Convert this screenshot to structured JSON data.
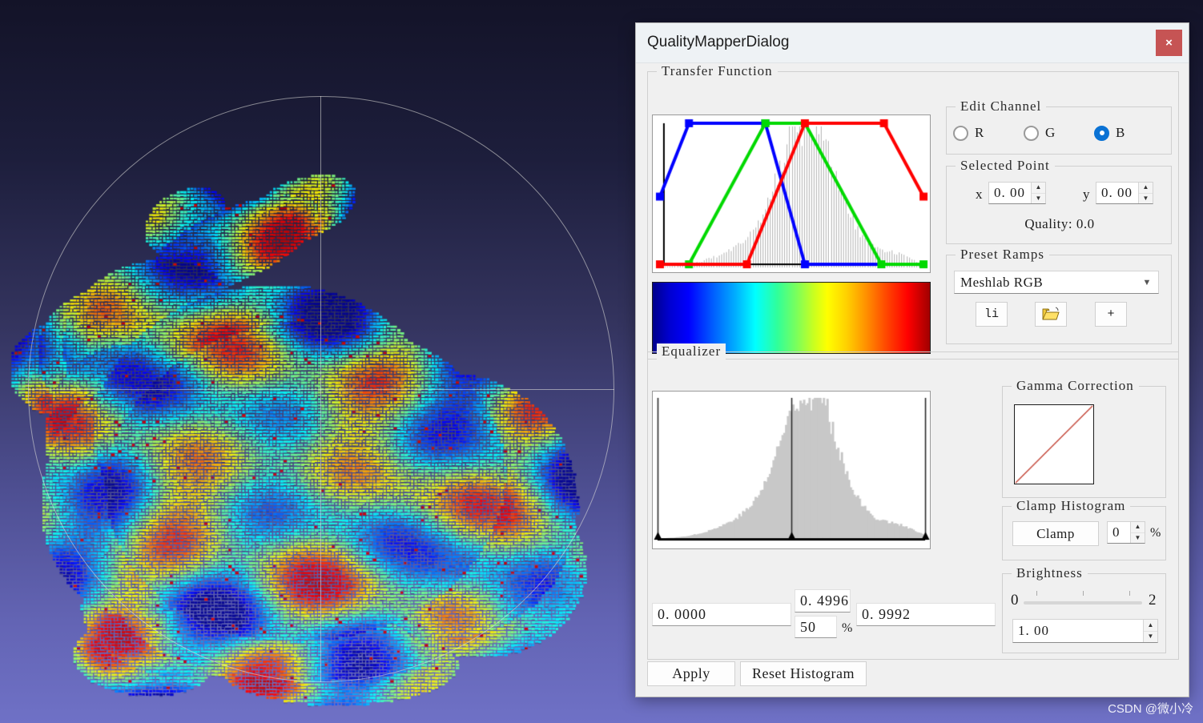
{
  "window": {
    "title": "QualityMapperDialog",
    "close_label": "×"
  },
  "transfer_function": {
    "group_title": "Transfer Function",
    "ramp_preview_name": "rainbow-jet-colormap"
  },
  "edit_channel": {
    "group_title": "Edit Channel",
    "options": [
      {
        "label": "R",
        "checked": false
      },
      {
        "label": "G",
        "checked": false
      },
      {
        "label": "B",
        "checked": true
      }
    ],
    "selected": "B",
    "accent_color": "#0a72d4"
  },
  "selected_point": {
    "group_title": "Selected Point",
    "x_label": "x",
    "x_value": "0. 00",
    "y_label": "y",
    "y_value": "0. 00",
    "quality_text": "Quality: 0.0"
  },
  "preset_ramps": {
    "group_title": "Preset Ramps",
    "selected": "Meshlab RGB",
    "buttons": [
      {
        "name": "list-button",
        "label": "li"
      },
      {
        "name": "open-folder-button",
        "label": ""
      },
      {
        "name": "add-button",
        "label": "+"
      }
    ]
  },
  "equalizer": {
    "group_title": "Equalizer",
    "min_value": "0. 0000",
    "mid_value": "0. 4996",
    "mid_percent": "50",
    "percent_sign": "%",
    "max_value": "0. 9992"
  },
  "gamma": {
    "group_title": "Gamma Correction",
    "curve_color": "#c0392b"
  },
  "clamp": {
    "group_title": "Clamp Histogram",
    "button_label": "Clamp",
    "value": "0",
    "percent_sign": "%"
  },
  "brightness": {
    "group_title": "Brightness",
    "min_label": "0",
    "max_label": "2",
    "value": "1. 00",
    "slider_position_percent": 50
  },
  "footer": {
    "apply_label": "Apply",
    "reset_label": "Reset Histogram"
  },
  "watermark": {
    "text": "CSDN @微小冷"
  },
  "chart_data": [
    {
      "type": "line",
      "name": "transfer-function-curves",
      "title": "Transfer Function",
      "xlim": [
        0,
        1
      ],
      "ylim": [
        0,
        1
      ],
      "grid": false,
      "series": [
        {
          "name": "R",
          "color": "#ff0000",
          "points": [
            [
              0.0,
              0.0
            ],
            [
              0.33,
              0.0
            ],
            [
              0.55,
              1.0
            ],
            [
              0.85,
              1.0
            ],
            [
              1.0,
              0.48
            ]
          ]
        },
        {
          "name": "G",
          "color": "#00d900",
          "points": [
            [
              0.0,
              0.0
            ],
            [
              0.11,
              0.0
            ],
            [
              0.4,
              1.0
            ],
            [
              0.55,
              1.0
            ],
            [
              0.84,
              0.0
            ],
            [
              1.0,
              0.0
            ]
          ]
        },
        {
          "name": "B",
          "color": "#0000ff",
          "points": [
            [
              0.0,
              0.48
            ],
            [
              0.11,
              1.0
            ],
            [
              0.4,
              1.0
            ],
            [
              0.55,
              0.0
            ],
            [
              0.84,
              0.0
            ],
            [
              1.0,
              0.0
            ]
          ]
        }
      ],
      "background_histogram": true
    },
    {
      "type": "bar",
      "name": "equalizer-histogram",
      "title": "Equalizer",
      "xlim": [
        0,
        1
      ],
      "ylim": [
        0,
        1
      ],
      "grid": false,
      "markers": [
        {
          "name": "min-marker",
          "x": 0.0,
          "value": "0. 0000"
        },
        {
          "name": "mid-marker",
          "x": 0.4996,
          "value": "0. 4996"
        },
        {
          "name": "max-marker",
          "x": 0.9992,
          "value": "0. 9992"
        }
      ],
      "bar_color": "#c8c8c8",
      "distribution": "unimodal-right-skewed, peak near x=0.56"
    },
    {
      "type": "line",
      "name": "gamma-correction-curve",
      "title": "Gamma Correction",
      "xlim": [
        0,
        1
      ],
      "ylim": [
        0,
        1
      ],
      "grid": false,
      "series": [
        {
          "name": "gamma",
          "color": "#c0392b",
          "points": [
            [
              0,
              0
            ],
            [
              1,
              1
            ]
          ]
        }
      ]
    }
  ]
}
